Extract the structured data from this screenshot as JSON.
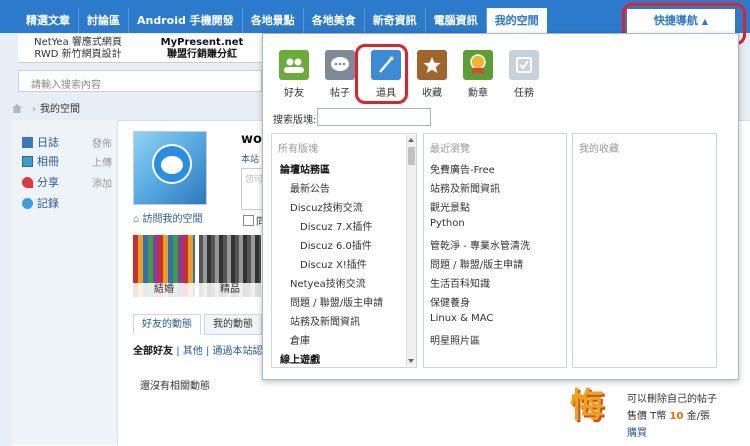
{
  "nav": {
    "tabs": [
      "精選文章",
      "討論區",
      "Android 手機開發",
      "各地景點",
      "各地美食",
      "新奇資訊",
      "電腦資訊",
      "我的空間"
    ],
    "active_index": 7,
    "quick_nav": "快捷導航"
  },
  "ads": [
    {
      "line1": "NetYea 響應式網頁",
      "line2": "RWD 新竹網頁設計"
    },
    {
      "line1": "MyPresent.net",
      "line2": "聯盟行銷賺分紅"
    }
  ],
  "search": {
    "placeholder": "請輸入搜索內容"
  },
  "breadcrumb": {
    "current": "我的空間"
  },
  "sidebar": [
    {
      "icon": "diary-icon",
      "label": "日誌",
      "action": "發佈",
      "color": "#3b78c0"
    },
    {
      "icon": "album-icon",
      "label": "相冊",
      "action": "上傳",
      "color": "#3b9ad0"
    },
    {
      "icon": "share-icon",
      "label": "分享",
      "action": "添加",
      "color": "#e03a3a"
    },
    {
      "icon": "record-icon",
      "label": "記錄",
      "action": "",
      "color": "#38a0e0"
    }
  ],
  "profile": {
    "username": "wof",
    "link": "本站",
    "textarea_hint": "您可",
    "checkbox_label": "同",
    "visit_label": "訪問我的空間"
  },
  "gallery": [
    {
      "caption": "結婚"
    },
    {
      "caption": "精品"
    }
  ],
  "feed": {
    "tabs": [
      "好友的動態",
      "我的動態"
    ],
    "filters": {
      "all": "全部好友",
      "other": "其他",
      "notify": "通過本站認識"
    },
    "empty": "還沒有相關動態"
  },
  "panel": {
    "apps": [
      {
        "icon": "friends-icon",
        "label": "好友",
        "color": "#6aab3a"
      },
      {
        "icon": "posts-icon",
        "label": "帖子",
        "color": "#7d8b99"
      },
      {
        "icon": "tools-icon",
        "label": "道具",
        "color": "#3a8cd8"
      },
      {
        "icon": "favorites-icon",
        "label": "收藏",
        "color": "#a0652a"
      },
      {
        "icon": "medal-icon",
        "label": "勳章",
        "color": "#5aa030"
      },
      {
        "icon": "tasks-icon",
        "label": "任務",
        "color": "#c0c8d0"
      }
    ],
    "search_label": "搜索版塊:",
    "columns": {
      "all": {
        "title": "所有版塊",
        "items": [
          {
            "text": "論壇站務區",
            "bold": true,
            "indent": 0
          },
          {
            "text": "最新公告",
            "bold": false,
            "indent": 1
          },
          {
            "text": "Discuz技術交流",
            "bold": false,
            "indent": 1
          },
          {
            "text": "Discuz 7.X插件",
            "bold": false,
            "indent": 2
          },
          {
            "text": "Discuz 6.0插件",
            "bold": false,
            "indent": 2
          },
          {
            "text": "Discuz X!插件",
            "bold": false,
            "indent": 2
          },
          {
            "text": "Netyea技術交流",
            "bold": false,
            "indent": 1
          },
          {
            "text": "問題 / 聯盟/版主申請",
            "bold": false,
            "indent": 1
          },
          {
            "text": "站務及新聞資訊",
            "bold": false,
            "indent": 1
          },
          {
            "text": "倉庫",
            "bold": false,
            "indent": 1
          },
          {
            "text": "線上遊戲",
            "bold": true,
            "indent": 0
          }
        ]
      },
      "recent": {
        "title": "最近瀏覽",
        "items": [
          "免費廣告-Free",
          "站務及新聞資訊",
          "觀光景點",
          "Python",
          "管乾淨 - 專業水管清洗",
          "問題 / 聯盟/版主申請",
          "生活百科知識",
          "保健養身",
          "Linux & MAC",
          "明星照片區"
        ]
      },
      "fav": {
        "title": "我的收藏"
      }
    }
  },
  "regret_card": {
    "glyph": "悔",
    "desc": "可以刪除自己的帖子",
    "price_pre": "售價 T幣",
    "price_num": "10",
    "price_post": "金/張",
    "buy": "購買"
  }
}
